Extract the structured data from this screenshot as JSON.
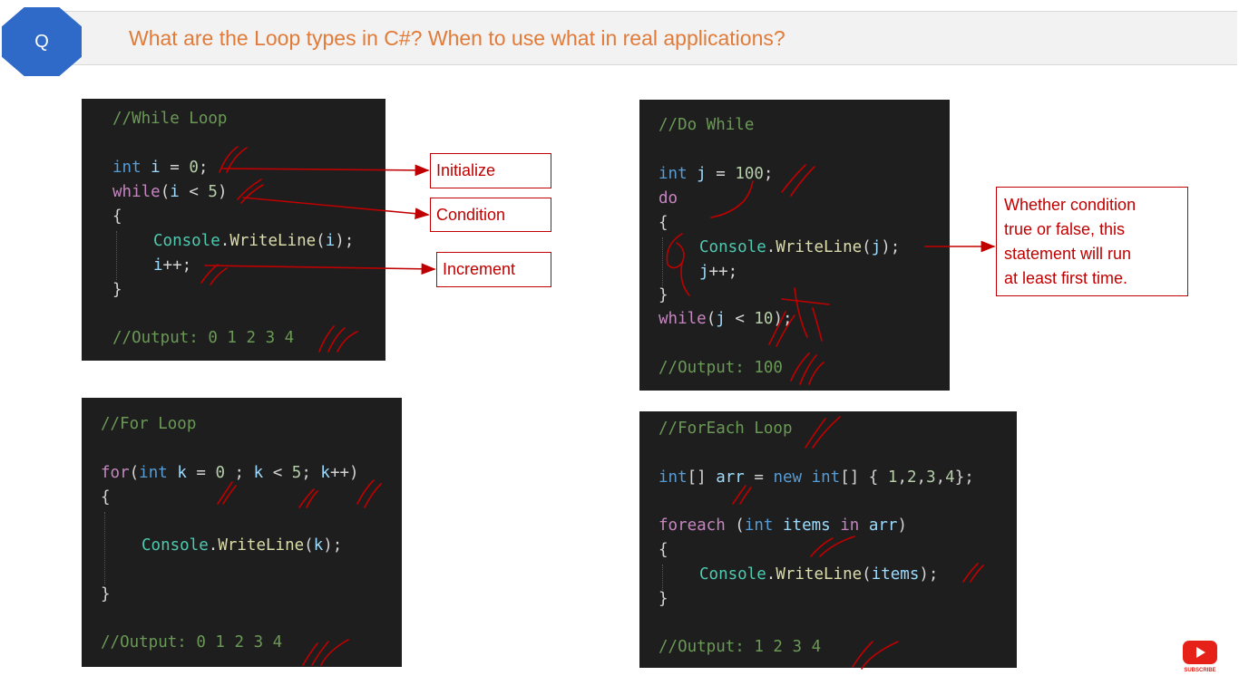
{
  "header": {
    "badge": "Q",
    "title": "What are the Loop types in C#? When to use what in real applications?"
  },
  "while_panel": {
    "comment": "//While Loop",
    "output": "//Output: 0 1 2 3 4"
  },
  "do_while_panel": {
    "comment": "//Do While",
    "output": "//Output: 100"
  },
  "for_panel": {
    "comment": "//For Loop",
    "output": "//Output: 0 1 2 3 4"
  },
  "foreach_panel": {
    "comment": "//ForEach Loop",
    "output": "//Output: 1 2 3 4"
  },
  "callouts": {
    "initialize": "Initialize",
    "condition": "Condition",
    "increment": "Increment",
    "do_while_note": [
      "Whether condition",
      "true or false, this",
      "statement will run",
      "at least first time."
    ]
  },
  "youtube": {
    "label": "SUBSCRIBE"
  },
  "colors": {
    "title": "#e07b39",
    "badge": "#2f6ac8",
    "annotation": "#c00000",
    "code_bg": "#1e1e1e"
  }
}
